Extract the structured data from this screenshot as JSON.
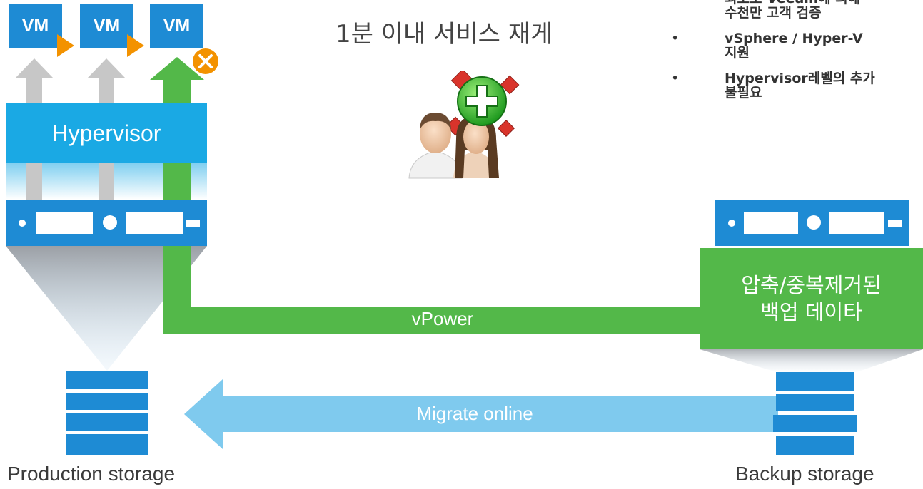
{
  "title": "1분 이내 서비스 재게",
  "bullets": [
    {
      "marker": "•",
      "lines": [
        "최초로 Veeam에 의해",
        "수천만 고객 검증"
      ]
    },
    {
      "marker": "•",
      "lines": [
        "vSphere / Hyper-V",
        "지원"
      ]
    },
    {
      "marker": "•",
      "lines": [
        "Hypervisor레벨의 추가",
        "불필요"
      ]
    }
  ],
  "vms": [
    {
      "label": "VM",
      "status": "running"
    },
    {
      "label": "VM",
      "status": "running"
    },
    {
      "label": "VM",
      "status": "failed"
    }
  ],
  "hypervisor_label": "Hypervisor",
  "backup_box": {
    "line1": "압축/중복제거된",
    "line2": "백업 데이타"
  },
  "vpower_label": "vPower",
  "migrate_label": "Migrate online",
  "production_storage_label": "Production storage",
  "backup_storage_label": "Backup storage",
  "icons": {
    "vm_play": "play-triangle-icon",
    "vm_error": "error-x-icon",
    "users": "users-add-icon"
  },
  "colors": {
    "vm_blue": "#1e8bd4",
    "hypervisor_blue": "#1aa9e4",
    "vpower_green": "#53b849",
    "migrate_blue": "#7fcaee",
    "arrow_gray": "#c7c7c7",
    "orange": "#f39200"
  }
}
